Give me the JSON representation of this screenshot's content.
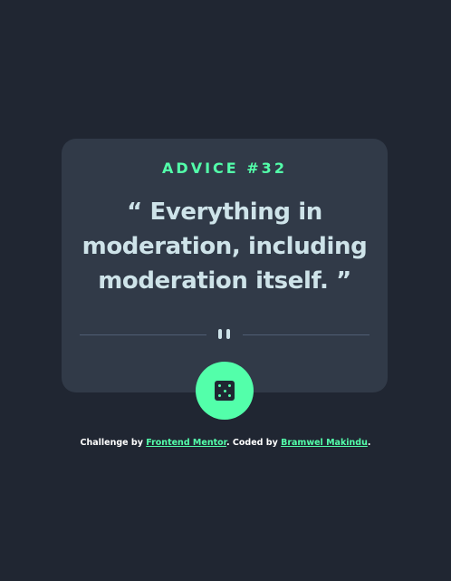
{
  "card": {
    "advice_id": "ADVICE #32",
    "advice_text": "“ Everything in moderation, including moderation itself. ”"
  },
  "divider": {
    "icon": "pause-icon"
  },
  "dice_button": {
    "icon": "dice-icon"
  },
  "footer": {
    "challenge_prefix": "Challenge by ",
    "challenge_link": "Frontend Mentor",
    "coded_prefix": ". Coded by ",
    "coded_link": "Bramwel Makindu",
    "suffix": "."
  },
  "colors": {
    "background": "#202632",
    "card": "#313a48",
    "accent": "#53ffaa",
    "text": "#cee3e9"
  }
}
